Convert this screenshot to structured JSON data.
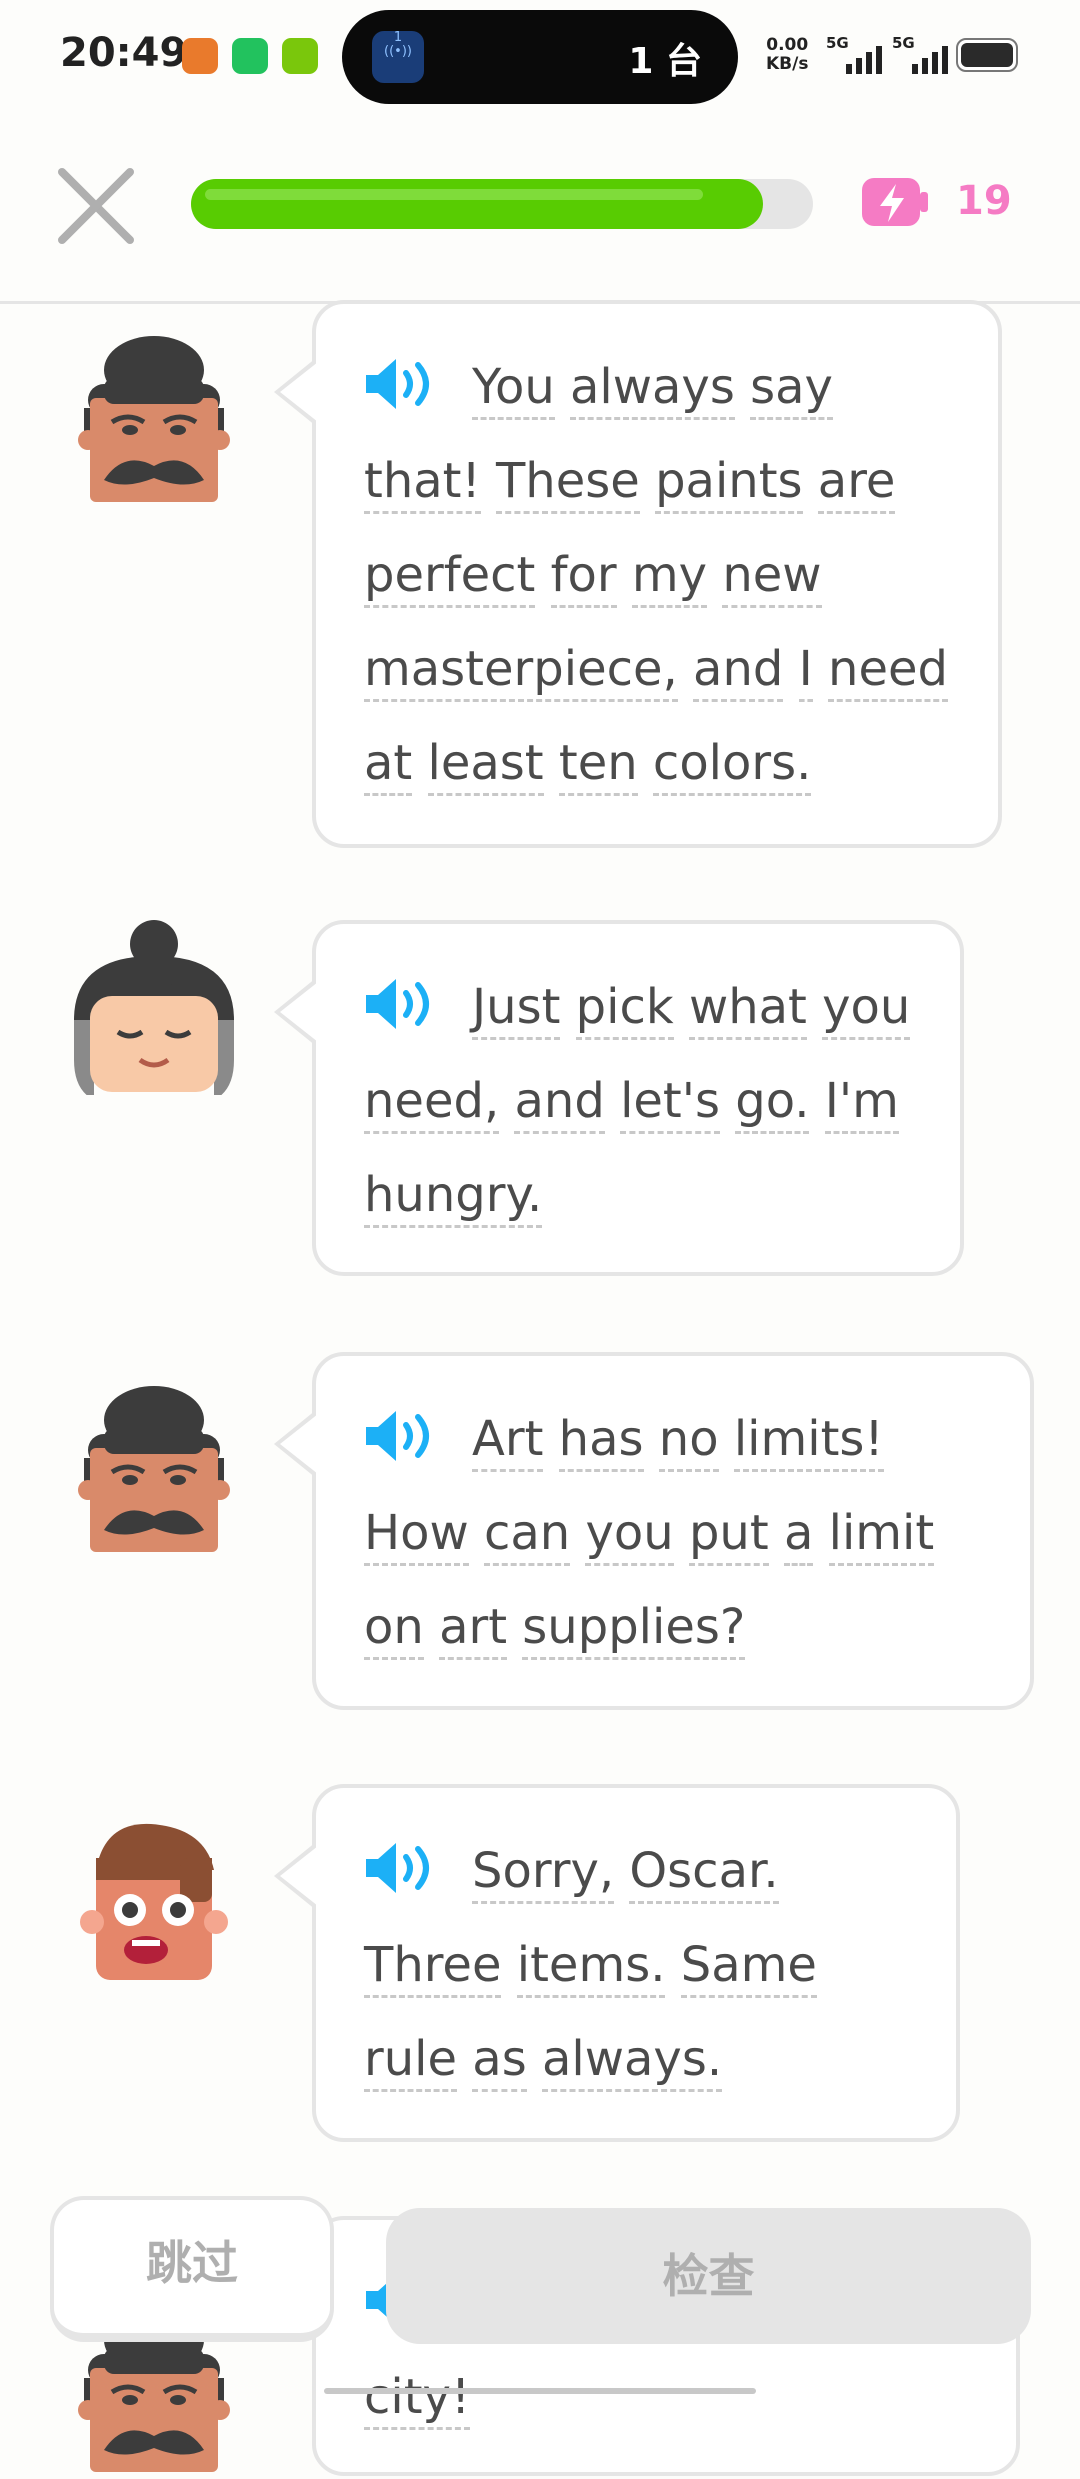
{
  "status_bar": {
    "time": "20:49",
    "island_icon_label": "1",
    "island_text": "1 台",
    "net_speed_value": "0.00",
    "net_speed_unit": "KB/s",
    "signal1_label": "5G",
    "signal2_label": "5G"
  },
  "header": {
    "progress": 0.92,
    "energy_count": "19"
  },
  "messages": [
    {
      "speaker": "oscar",
      "text": "You always say that! These paints are perfect for my new masterpiece, and I need at least ten colors."
    },
    {
      "speaker": "lin",
      "text": "Just pick what you need, and let's go. I'm hungry."
    },
    {
      "speaker": "oscar",
      "text": "Art has no limits! How can you put a limit on art supplies?"
    },
    {
      "speaker": "duo-man",
      "text": "Sorry, Oscar. Three items. Same rule as always."
    },
    {
      "speaker": "oscar",
      "text": "beautiful shop in the city!"
    }
  ],
  "buttons": {
    "skip_label": "跳过",
    "check_label": "检查"
  },
  "colors": {
    "progress_green": "#58cc02",
    "energy_pink": "#f57bc4",
    "speaker_blue": "#1cb0f6"
  },
  "icons": [
    "close-icon",
    "energy-battery-icon",
    "speaker-icon"
  ]
}
